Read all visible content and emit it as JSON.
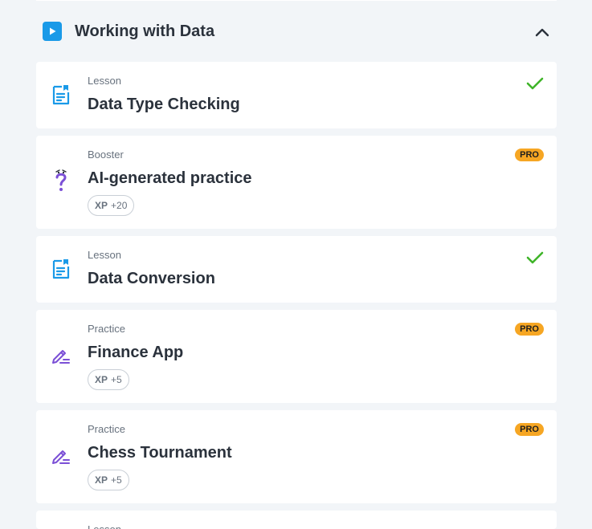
{
  "section": {
    "title": "Working with Data"
  },
  "items": [
    {
      "kind": "Lesson",
      "title": "Data Type Checking",
      "completed": true,
      "pro": "",
      "xp_label": "",
      "xp_value": ""
    },
    {
      "kind": "Booster",
      "title": "AI-generated practice",
      "completed": false,
      "pro": "PRO",
      "xp_label": "XP",
      "xp_value": "+20"
    },
    {
      "kind": "Lesson",
      "title": "Data Conversion",
      "completed": true,
      "pro": "",
      "xp_label": "",
      "xp_value": ""
    },
    {
      "kind": "Practice",
      "title": "Finance App",
      "completed": false,
      "pro": "PRO",
      "xp_label": "XP",
      "xp_value": "+5"
    },
    {
      "kind": "Practice",
      "title": "Chess Tournament",
      "completed": false,
      "pro": "PRO",
      "xp_label": "XP",
      "xp_value": "+5"
    },
    {
      "kind": "Lesson",
      "title": "",
      "completed": false,
      "pro": "",
      "xp_label": "",
      "xp_value": ""
    }
  ],
  "colors": {
    "accent_blue": "#1a9ae8",
    "check_green": "#3fb429",
    "purple": "#7b4fd6",
    "pro_orange": "#f6a623"
  }
}
